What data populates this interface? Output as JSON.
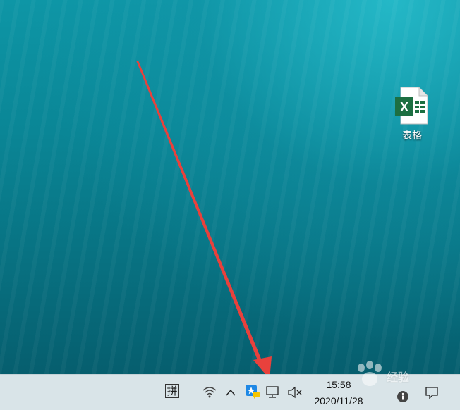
{
  "desktop": {
    "icons": [
      {
        "label": "表格",
        "icon": "excel-file-icon",
        "badge": "X"
      }
    ]
  },
  "taskbar": {
    "ime_label": "拼",
    "clock": {
      "time": "15:58",
      "date": "2020/11/28"
    },
    "tray_icons": [
      "wifi-icon",
      "chevron-up-icon",
      "app-tray-icon",
      "network-icon",
      "volume-muted-icon",
      "notification-icon",
      "info-icon"
    ]
  },
  "annotation": {
    "color": "#e8413c"
  },
  "watermark": {
    "text": "经验"
  },
  "colors": {
    "excel_green": "#1d6f42",
    "taskbar_bg": "#d9e4e8"
  }
}
